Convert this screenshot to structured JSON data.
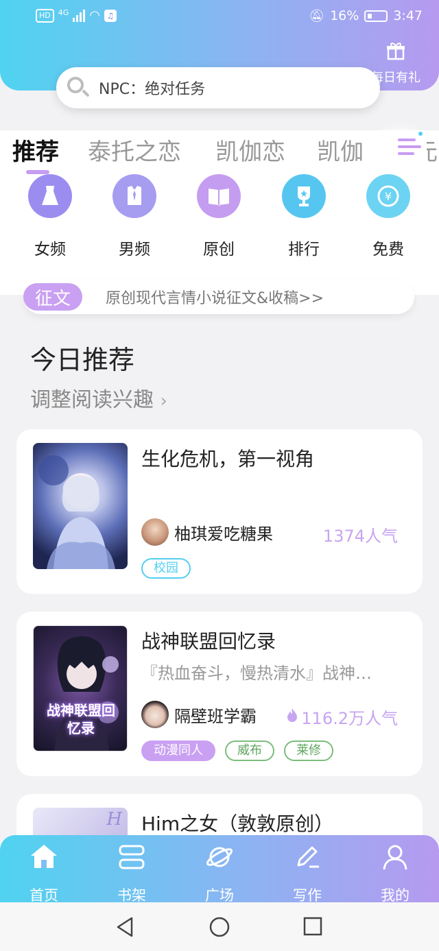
{
  "status_bar": {
    "network": "4G",
    "battery": "16%",
    "time": "3:47",
    "hd_label": "HD"
  },
  "header": {
    "gift_label": "每日有礼"
  },
  "search": {
    "placeholder": "NPC：绝对任务"
  },
  "tabs": [
    {
      "label": "推荐",
      "active": true
    },
    {
      "label": "泰托之恋",
      "active": false
    },
    {
      "label": "凯伽恋",
      "active": false
    },
    {
      "label": "凯伽",
      "active": false
    },
    {
      "label": "赛元",
      "active": false
    }
  ],
  "quick_entries": [
    {
      "label": "女频",
      "icon": "dress-icon",
      "color": "#9b8df0"
    },
    {
      "label": "男频",
      "icon": "shirt-icon",
      "color": "#a69cf0"
    },
    {
      "label": "原创",
      "icon": "book-icon",
      "color": "#c49df0"
    },
    {
      "label": "排行",
      "icon": "trophy-icon",
      "color": "#56c6f0"
    },
    {
      "label": "免费",
      "icon": "coin-icon",
      "color": "#6dd3f2"
    }
  ],
  "banner": {
    "badge": "征文",
    "text": "原创现代言情小说征文&收稿>>"
  },
  "section": {
    "title": "今日推荐",
    "subtitle": "调整阅读兴趣"
  },
  "books": [
    {
      "title": "生化危机，第一视角",
      "description": "",
      "author": "柚琪爱吃糖果",
      "popularity": "1374人气",
      "hot": false,
      "tags": [
        {
          "label": "校园",
          "color": "#53cff0"
        }
      ]
    },
    {
      "title": "战神联盟回忆录",
      "description": "『热血奋斗，慢热清水』战神…",
      "author": "隔壁班学霸",
      "popularity": "116.2万人气",
      "hot": true,
      "cover_text": "战神联盟回忆录",
      "tags": [
        {
          "label": "动漫同人",
          "color": "#c9a0f2",
          "filled": true
        },
        {
          "label": "威布",
          "color": "#7bbd7b"
        },
        {
          "label": "莱修",
          "color": "#7bbd7b"
        }
      ]
    },
    {
      "title": "Him之女（敦敦原创）",
      "description": "",
      "author": "",
      "popularity": "",
      "cover_text": "H",
      "tags": []
    }
  ],
  "bottom_nav": [
    {
      "label": "首页",
      "icon": "home-icon",
      "active": true
    },
    {
      "label": "书架",
      "icon": "bookshelf-icon",
      "active": false
    },
    {
      "label": "广场",
      "icon": "planet-icon",
      "active": false
    },
    {
      "label": "写作",
      "icon": "pen-icon",
      "active": false
    },
    {
      "label": "我的",
      "icon": "profile-icon",
      "active": false
    }
  ],
  "colors": {
    "gradient_start": "#4fd3f0",
    "gradient_end": "#b69af0",
    "accent_purple": "#c9a0f2",
    "accent_cyan": "#53cff0"
  }
}
